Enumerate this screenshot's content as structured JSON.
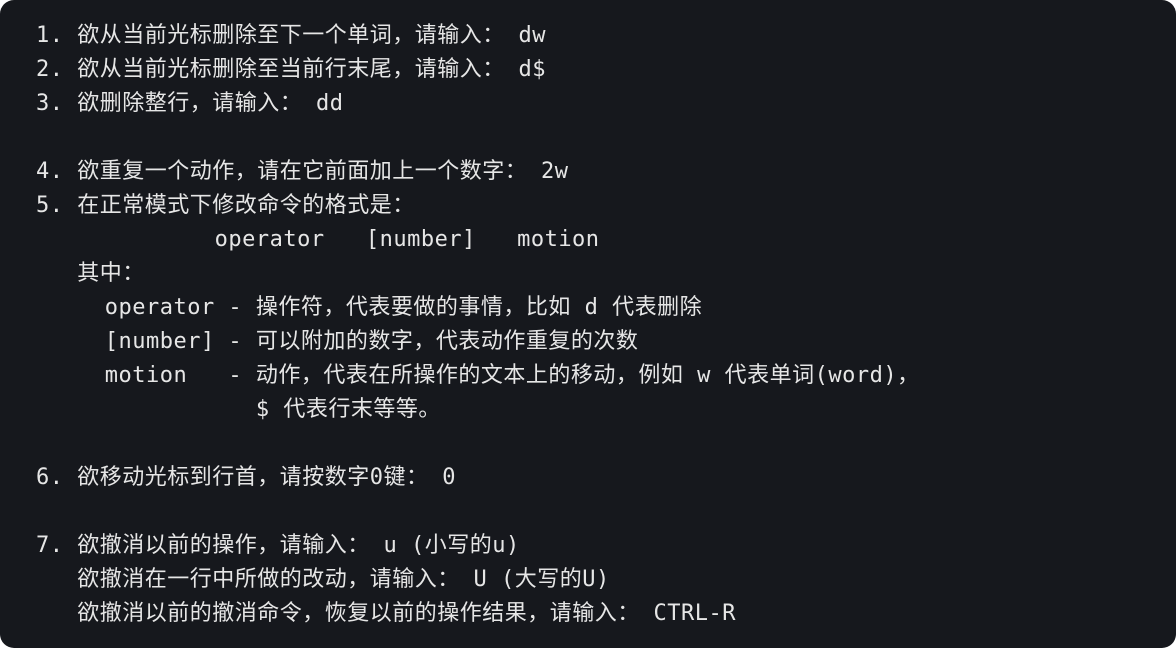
{
  "terminal": {
    "lines": [
      "1. 欲从当前光标删除至下一个单词，请输入： dw",
      "2. 欲从当前光标删除至当前行末尾，请输入： d$",
      "3. 欲删除整行，请输入： dd",
      "",
      "4. 欲重复一个动作，请在它前面加上一个数字： 2w",
      "5. 在正常模式下修改命令的格式是：",
      "             operator   [number]   motion",
      "   其中：",
      "     operator - 操作符，代表要做的事情，比如 d 代表删除",
      "     [number] - 可以附加的数字，代表动作重复的次数",
      "     motion   - 动作，代表在所操作的文本上的移动，例如 w 代表单词(word)，",
      "                $ 代表行末等等。",
      "",
      "6. 欲移动光标到行首，请按数字0键： 0",
      "",
      "7. 欲撤消以前的操作，请输入： u (小写的u)",
      "   欲撤消在一行中所做的改动，请输入： U (大写的U)",
      "   欲撤消以前的撤消命令，恢复以前的操作结果，请输入： CTRL-R"
    ]
  }
}
